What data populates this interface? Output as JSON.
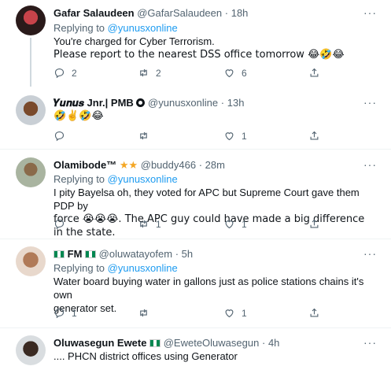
{
  "tweets": [
    {
      "name": "Gafar Salaudeen",
      "handle": "@GafarSalaudeen",
      "sep": "·",
      "time": "18h",
      "replying_label": "Replying to",
      "replying_to": "@yunusxonline",
      "line1": "You're charged for Cyber Terrorism.",
      "line2": "Please report to the nearest DSS office tomorrow 😂🤣😂",
      "replies": "2",
      "retweets": "2",
      "likes": "6"
    },
    {
      "name": "𝒀𝒖𝒏𝒖𝒔 Jnr.| PMB",
      "handle": "@yunusxonline",
      "sep": "·",
      "time": "13h",
      "line1": "🤣✌️🤣😂",
      "replies": "",
      "retweets": "",
      "likes": "1"
    },
    {
      "name": "Olamibode™",
      "stars": "★★",
      "handle": "@buddy466",
      "sep": "·",
      "time": "28m",
      "replying_label": "Replying to",
      "replying_to": "@yunusxonline",
      "line1": "I pity Bayelsa oh, they voted for APC but Supreme Court gave them PDP by",
      "line2": "force 😭😭😭. The APC guy could have made a big difference in the state.",
      "replies": "",
      "retweets": "1",
      "likes": "1"
    },
    {
      "name": "FM",
      "handle": "@oluwatayofem",
      "sep": "·",
      "time": "5h",
      "replying_label": "Replying to",
      "replying_to": "@yunusxonline",
      "line1": "Water board buying water in gallons just as police stations chains it's own",
      "line2": "generator set.",
      "replies": "1",
      "retweets": "",
      "likes": "1"
    },
    {
      "name": "Oluwasegun Ewete",
      "handle": "@EweteOluwasegun",
      "sep": "·",
      "time": "4h",
      "line1": ".... PHCN district offices using Generator"
    }
  ],
  "more_label": "···"
}
